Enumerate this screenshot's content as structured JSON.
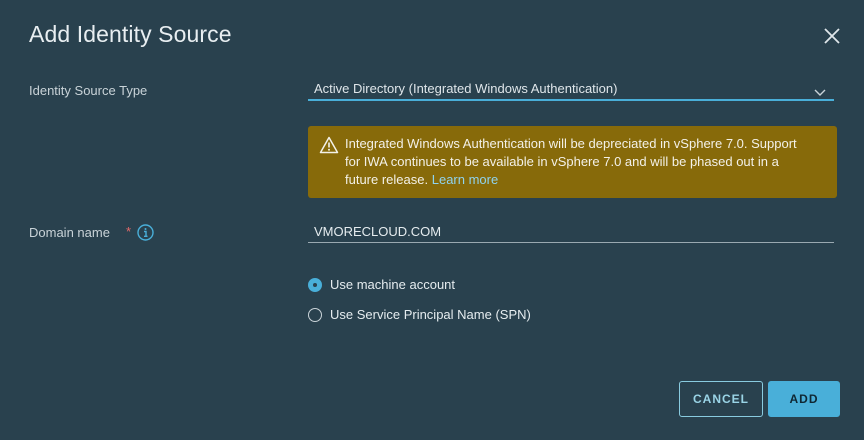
{
  "dialog": {
    "title": "Add Identity Source",
    "close_icon": "close-icon"
  },
  "form": {
    "source_type": {
      "label": "Identity Source Type",
      "value": "Active Directory (Integrated Windows Authentication)",
      "icon": "chevron-down-icon"
    },
    "alert": {
      "icon": "warning-icon",
      "message": "Integrated Windows Authentication will be depreciated in vSphere 7.0. Support for IWA continues to be available in vSphere 7.0 and will be phased out in a future release.",
      "link": "Learn more",
      "color": "#876a0a"
    },
    "domain": {
      "label": "Domain name",
      "required_mark": "*",
      "info_icon": "info-icon",
      "value": "VMORECLOUD.COM"
    },
    "account_options": [
      {
        "label": "Use machine account",
        "selected": true
      },
      {
        "label": "Use Service Principal Name (SPN)",
        "selected": false
      }
    ]
  },
  "footer": {
    "cancel_label": "CANCEL",
    "add_label": "ADD"
  },
  "colors": {
    "background": "#29414e",
    "accent": "#49afd9"
  }
}
